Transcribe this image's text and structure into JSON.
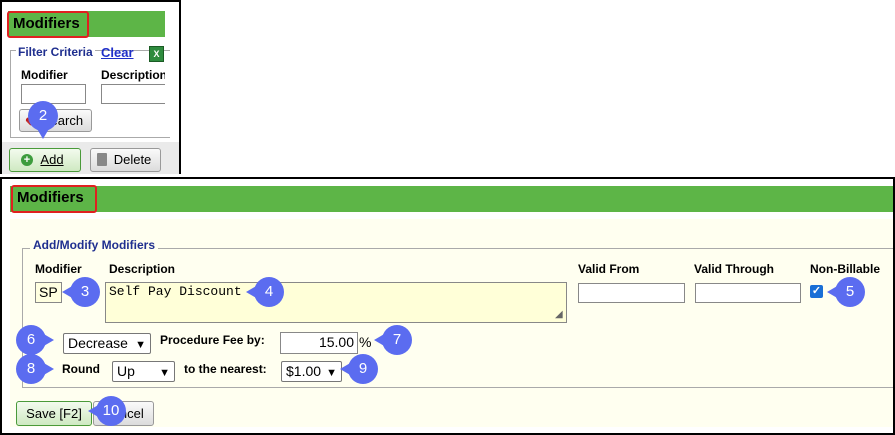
{
  "top_panel": {
    "title": "Modifiers",
    "filter_label": "Filter Criteria",
    "clear_link": "Clear",
    "col_modifier": "Modifier",
    "col_description": "Description",
    "search_label": "Search",
    "add_label": "Add",
    "delete_label": "Delete"
  },
  "form_panel": {
    "title": "Modifiers",
    "legend": "Add/Modify Modifiers",
    "modifier_label": "Modifier",
    "description_label": "Description",
    "valid_from_label": "Valid From",
    "valid_through_label": "Valid Through",
    "non_billable_label": "Non-Billable",
    "modifier_value": "SP",
    "description_value": "Self Pay Discount",
    "valid_from_value": "",
    "valid_through_value": "",
    "non_billable_checked": true,
    "fee_direction": "Decrease",
    "fee_label": "Procedure Fee by:",
    "fee_value": "15.00",
    "fee_unit": "%",
    "round_label": "Round",
    "round_direction": "Up",
    "nearest_label": "to the nearest:",
    "nearest_value": "$1.00",
    "save_label": "Save [F2]",
    "cancel_label": "Cancel"
  },
  "callouts": [
    "2",
    "3",
    "4",
    "5",
    "6",
    "7",
    "8",
    "9",
    "10"
  ],
  "colors": {
    "header_green": "#5db547",
    "highlight_red": "#e02020",
    "callout_blue": "#5b6cf0",
    "legend_blue": "#1f2f8f",
    "form_bg": "#fffff0"
  }
}
